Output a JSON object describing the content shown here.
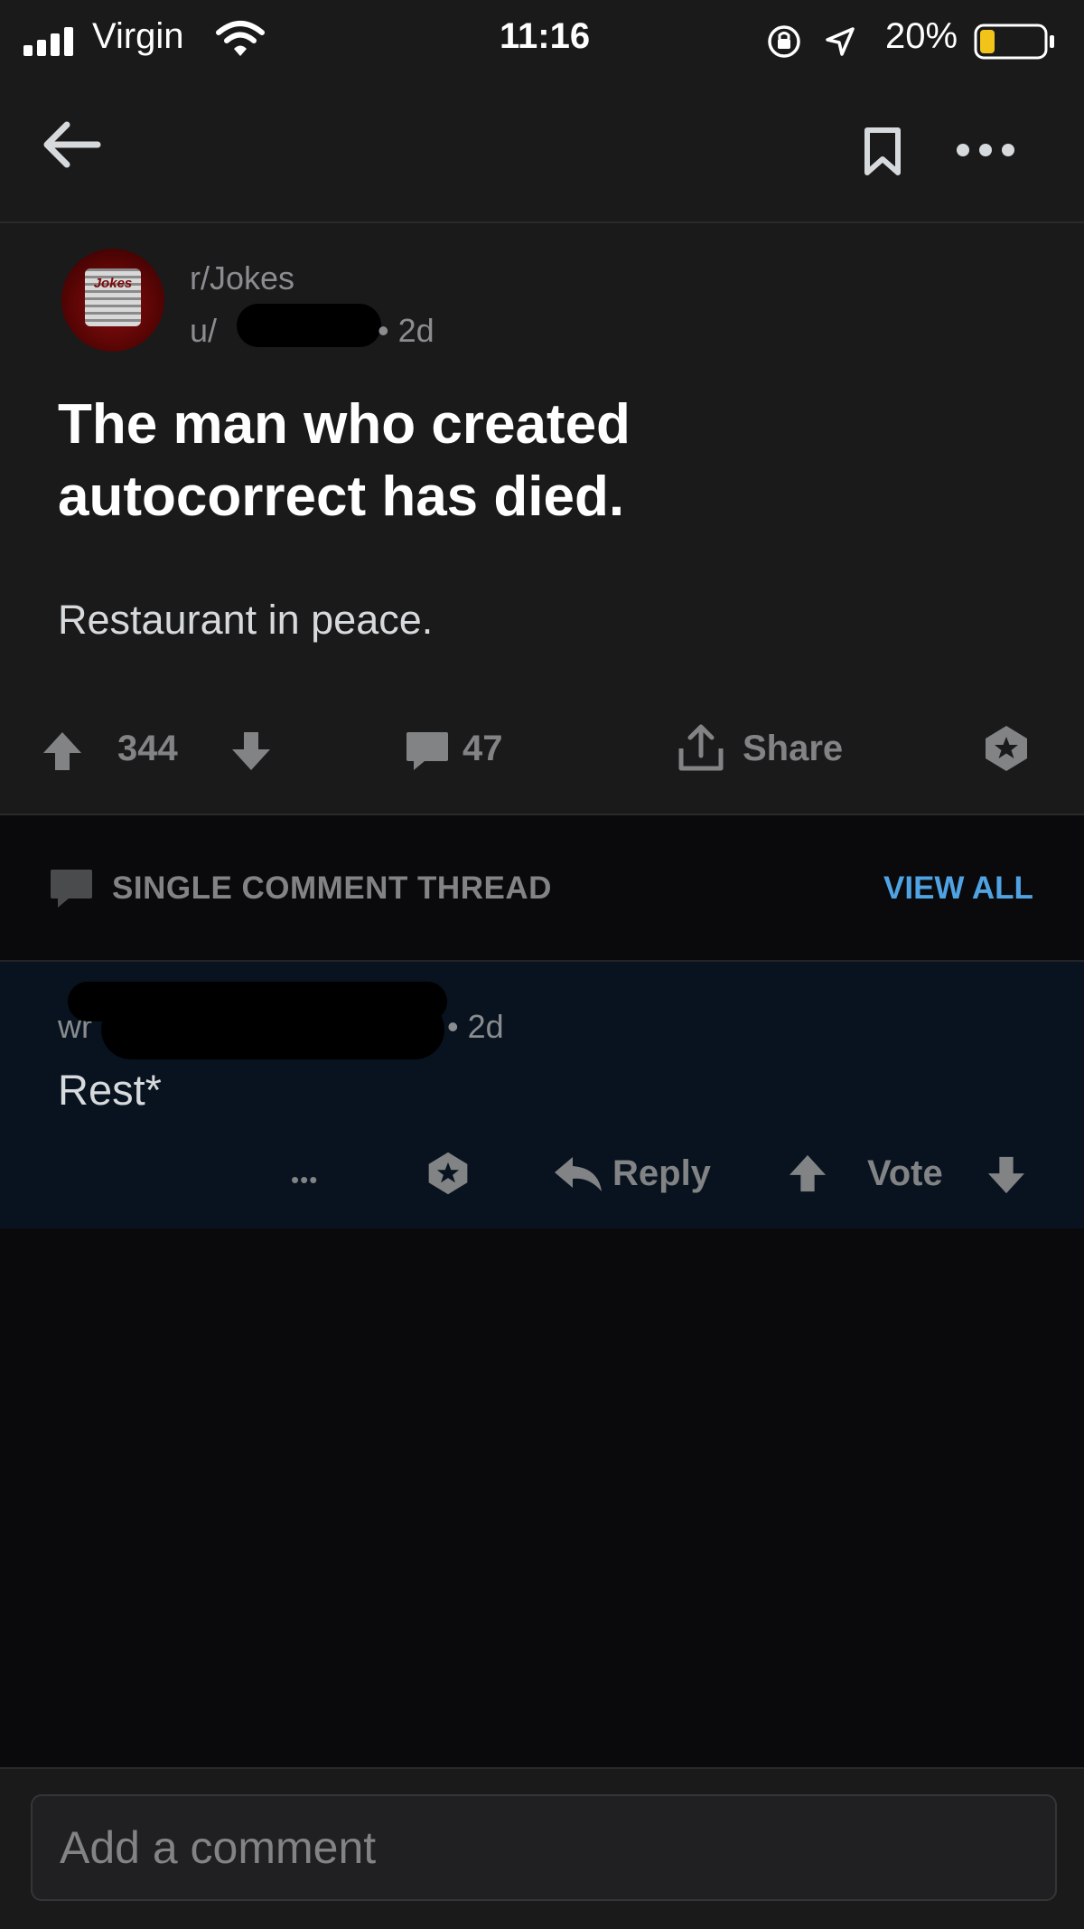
{
  "status_bar": {
    "carrier": "Virgin",
    "time": "11:16",
    "battery": "20%",
    "battery_level": 0.2
  },
  "post": {
    "subreddit": "r/Jokes",
    "user_prefix": "u/",
    "age": "• 2d",
    "avatar_text": "Jokes",
    "title_line1": "The man who created",
    "title_line2": "autocorrect has died.",
    "body": "Restaurant in peace.",
    "score": "344",
    "comments": "47",
    "share_label": "Share"
  },
  "thread": {
    "label": "SINGLE COMMENT THREAD",
    "view_all": "VIEW ALL"
  },
  "comment": {
    "user_prefix": "wr",
    "age": "• 2d",
    "text": "Rest*",
    "more": "•••",
    "reply_label": "Reply",
    "vote_label": "Vote"
  },
  "composer": {
    "placeholder": "Add a comment"
  },
  "colors": {
    "background": "#0a0a0c",
    "surface": "#1a1a1b",
    "comment_highlight": "#08131f",
    "accent": "#4fa3e3",
    "muted": "#818384"
  }
}
